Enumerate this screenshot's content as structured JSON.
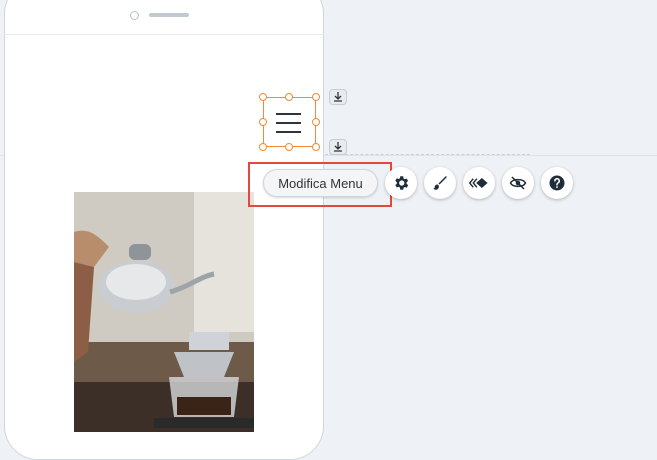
{
  "toolbar": {
    "edit_menu_label": "Modifica Menu",
    "icons": [
      "gear-icon",
      "brush-icon",
      "animation-icon",
      "hide-icon",
      "help-icon"
    ]
  },
  "colors": {
    "selection": "#f08a3a",
    "highlight": "#e2483d",
    "canvas": "#eef1f5"
  }
}
